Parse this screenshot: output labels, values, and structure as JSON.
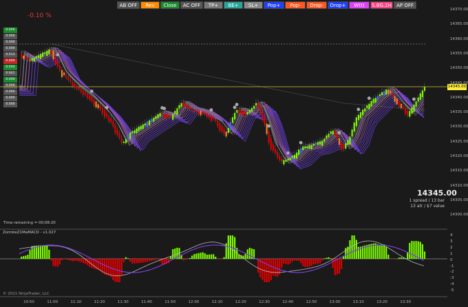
{
  "toolbar": [
    {
      "label": "AB OFF",
      "color": "#555555"
    },
    {
      "label": "Rev",
      "color": "#ff8c00"
    },
    {
      "label": "Close",
      "color": "#1b8a2e"
    },
    {
      "label": "AC OFF",
      "color": "#555555"
    },
    {
      "label": "TP+",
      "color": "#777777"
    },
    {
      "label": "BE+",
      "color": "#26a69a"
    },
    {
      "label": "SL+",
      "color": "#888888"
    },
    {
      "label": "Pop+",
      "color": "#1e40ff"
    },
    {
      "label": "Pop-",
      "color": "#ff5722"
    },
    {
      "label": "Drop-",
      "color": "#ff5722"
    },
    {
      "label": "Drop+",
      "color": "#1e40ff"
    },
    {
      "label": "W(t)",
      "color": "#e040fb"
    },
    {
      "label": "S.BG.2H",
      "color": "#ff4081"
    },
    {
      "label": "AP OFF",
      "color": "#555555"
    }
  ],
  "ladder": [
    {
      "text": "0.000",
      "color": "#1b8a2e"
    },
    {
      "text": "0.000",
      "color": "#555555"
    },
    {
      "text": "0.000",
      "color": "#555555"
    },
    {
      "text": "0.000",
      "color": "#555555"
    },
    {
      "text": "0.013",
      "color": "#555555"
    },
    {
      "text": "0.000",
      "color": "#c62828"
    },
    {
      "text": "0.044",
      "color": "#1b8a2e"
    },
    {
      "text": "0.041",
      "color": "#555555"
    },
    {
      "text": "0.000",
      "color": "#1b8a2e"
    },
    {
      "text": "0.000",
      "color": "#555555"
    },
    {
      "text": "0.000",
      "color": "#555555"
    },
    {
      "text": "0.000",
      "color": "#555555"
    },
    {
      "text": "0.000",
      "color": "#555555"
    }
  ],
  "percent_change": "-0.10 %",
  "price_axis": [
    "14370.00",
    "14365.00",
    "14360.00",
    "14355.00",
    "14350.00",
    "14345.00",
    "14340.00",
    "14335.00",
    "14330.00",
    "14325.00",
    "14320.00",
    "14315.00",
    "14310.00",
    "14305.00",
    "14300.00"
  ],
  "current_price_tag": "14345.00",
  "big_price": "14345.00",
  "info_lines": [
    "1 spread / 13 bar",
    "13 atr / $7 value"
  ],
  "time_remaining": "Time remaining = 00:08:20",
  "indicator_label": "ZombieZ1MaMACD - v1.027",
  "indicator_axis": [
    "4",
    "3",
    "2",
    "1",
    "0",
    "-1",
    "-2",
    "-3",
    "-4",
    "-5"
  ],
  "x_axis": [
    "10:50",
    "11:00",
    "11:10",
    "11:20",
    "11:30",
    "11:40",
    "11:50",
    "12:00",
    "12:10",
    "12:20",
    "12:30",
    "12:40",
    "12:50",
    "13:00",
    "13:10",
    "13:20",
    "13:30"
  ],
  "copyright": "© 2021 NinjaTrader, LLC",
  "colors": {
    "background": "#1a1a1a",
    "up": "#7cfc00",
    "down": "#e00000",
    "ribbon": "#8a2be2",
    "price_line": "#ffeb3b"
  }
}
